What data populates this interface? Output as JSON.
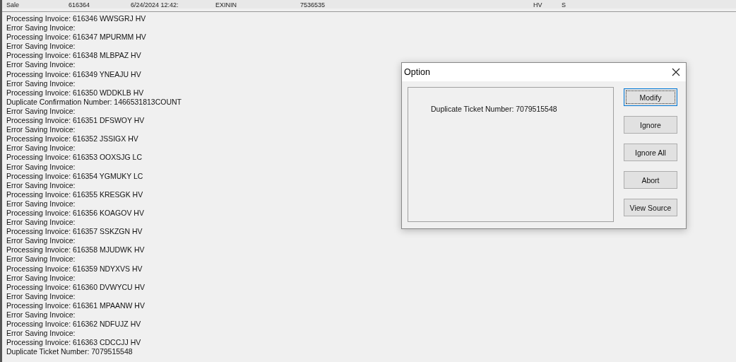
{
  "header_row": {
    "cells": [
      "Sale",
      "616364",
      "6/24/2024 12:42:",
      "EXININ",
      "7536535",
      "HV",
      "S"
    ]
  },
  "log": {
    "lines": [
      "Processing Invoice: 616346 WWSGRJ HV",
      "Error Saving Invoice:",
      "Processing Invoice: 616347 MPURMM HV",
      "Error Saving Invoice:",
      "Processing Invoice: 616348 MLBPAZ HV",
      "Error Saving Invoice:",
      "Processing Invoice: 616349 YNEAJU HV",
      "Error Saving Invoice:",
      "Processing Invoice: 616350 WDDKLB HV",
      "Duplicate Confirmation Number: 1466531813COUNT",
      "Error Saving Invoice:",
      "Processing Invoice: 616351 DFSWOY HV",
      "Error Saving Invoice:",
      "Processing Invoice: 616352 JSSIGX HV",
      "Error Saving Invoice:",
      "Processing Invoice: 616353 OOXSJG LC",
      "Error Saving Invoice:",
      "Processing Invoice: 616354 YGMUKY LC",
      "Error Saving Invoice:",
      "Processing Invoice: 616355 KRESGK HV",
      "Error Saving Invoice:",
      "Processing Invoice: 616356 KOAGOV HV",
      "Error Saving Invoice:",
      "Processing Invoice: 616357 SSKZGN HV",
      "Error Saving Invoice:",
      "Processing Invoice: 616358 MJUDWK HV",
      "Error Saving Invoice:",
      "Processing Invoice: 616359 NDYXVS HV",
      "Error Saving Invoice:",
      "Processing Invoice: 616360 DVWYCU HV",
      "Error Saving Invoice:",
      "Processing Invoice: 616361 MPAANW HV",
      "Error Saving Invoice:",
      "Processing Invoice: 616362 NDFUJZ HV",
      "Error Saving Invoice:",
      "Processing Invoice: 616363 CDCCJJ HV",
      "Duplicate Ticket Number: 7079515548"
    ]
  },
  "dialog": {
    "title": "Option",
    "message": "Duplicate Ticket Number: 7079515548",
    "buttons": [
      {
        "label": "Modify",
        "focused": true
      },
      {
        "label": "Ignore",
        "focused": false
      },
      {
        "label": "Ignore All",
        "focused": false
      },
      {
        "label": "Abort",
        "focused": false
      },
      {
        "label": "View Source",
        "focused": false
      }
    ]
  }
}
